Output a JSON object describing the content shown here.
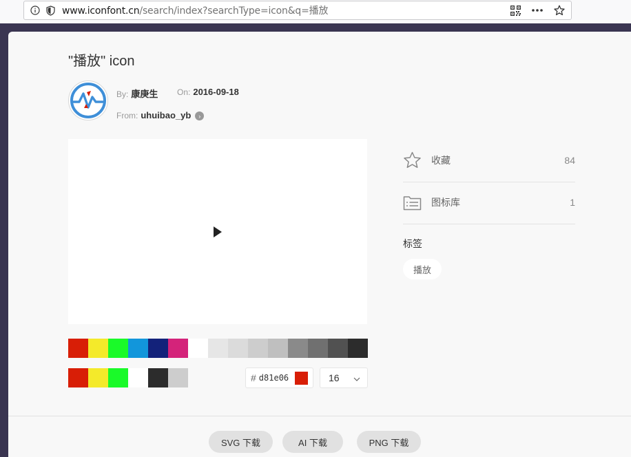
{
  "browser": {
    "url_host": "www.iconfont.cn",
    "url_path": "/search/index?searchType=icon&q=播放"
  },
  "icon": {
    "title": "\"播放\" icon",
    "by_label": "By:",
    "author": "康庚生",
    "on_label": "On:",
    "date": "2016-09-18",
    "from_label": "From:",
    "library": "uhuibao_yb"
  },
  "palette": {
    "row1": [
      "#d81e06",
      "#f4ea2a",
      "#1afa29",
      "#1296db",
      "#13227a",
      "#d4237a",
      "#ffffff",
      "#e6e6e6",
      "#dbdbdb",
      "#cdcdcd",
      "#bfbfbf",
      "#8a8a8a",
      "#707070",
      "#515151",
      "#2c2c2c"
    ],
    "row2": [
      "#d81e06",
      "#f4ea2a",
      "#1afa29",
      "#ffffff",
      "#2c2c2c",
      "#cdcdcd"
    ]
  },
  "color_picker": {
    "hash": "#",
    "value": "d81e06",
    "chip_color": "#d81e06"
  },
  "size_select": {
    "value": "16"
  },
  "stats": {
    "collect_label": "收藏",
    "collect_count": "84",
    "library_label": "图标库",
    "library_count": "1"
  },
  "tags": {
    "title": "标签",
    "items": [
      "播放"
    ]
  },
  "downloads": {
    "svg": "SVG 下载",
    "ai": "AI 下载",
    "png": "PNG 下载"
  }
}
